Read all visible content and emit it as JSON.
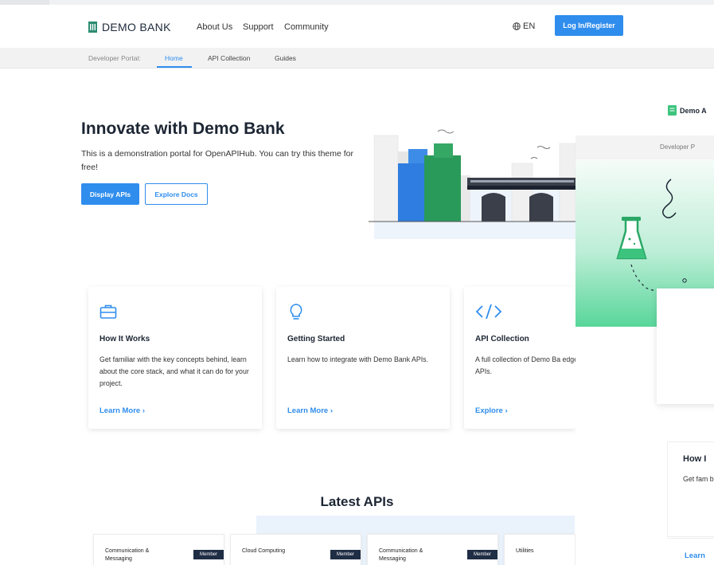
{
  "header": {
    "brand": "DEMO BANK",
    "nav": [
      "About Us",
      "Support",
      "Community"
    ],
    "language": "EN",
    "login_label": "Log In/Register"
  },
  "subnav": {
    "label": "Developer Portal:",
    "items": [
      "Home",
      "API Collection",
      "Guides"
    ],
    "active": "Home"
  },
  "hero": {
    "title": "Innovate with Demo Bank",
    "subtitle": "This is a demonstration portal for OpenAPIHub. You can try this theme for free!",
    "primary_button": "Display APIs",
    "secondary_button": "Explore Docs"
  },
  "features": [
    {
      "icon": "briefcase-icon",
      "title": "How It Works",
      "text": "Get familiar with the key concepts behind, learn about the core stack, and what it can do for your project.",
      "link": "Learn More ›"
    },
    {
      "icon": "lightbulb-icon",
      "title": "Getting Started",
      "text": "Learn how to integrate with Demo Bank APIs.",
      "link": "Learn More ›"
    },
    {
      "icon": "code-icon",
      "title": "API Collection",
      "text": "A full collection of Demo Ba edge APIs.",
      "link": "Explore ›"
    }
  ],
  "latest": {
    "title": "Latest APIs",
    "apis": [
      {
        "category": "Communication & Messaging",
        "badge": "Member"
      },
      {
        "category": "Cloud Computing",
        "badge": "Member"
      },
      {
        "category": "Communication & Messaging",
        "badge": "Member"
      },
      {
        "category": "Utilities",
        "badge": ""
      }
    ]
  },
  "overlay_panel": {
    "brand": "Demo A",
    "subnav_label": "Developer P",
    "section_title": "How I",
    "section_text": "Get fam behind, what it",
    "link": "Learn"
  },
  "colors": {
    "accent": "#2f8ded",
    "brand_dark": "#1c2533",
    "brand_icon": "#2c8c72",
    "badge": "#1f2d45",
    "green_gradient_end": "#58d69a"
  }
}
